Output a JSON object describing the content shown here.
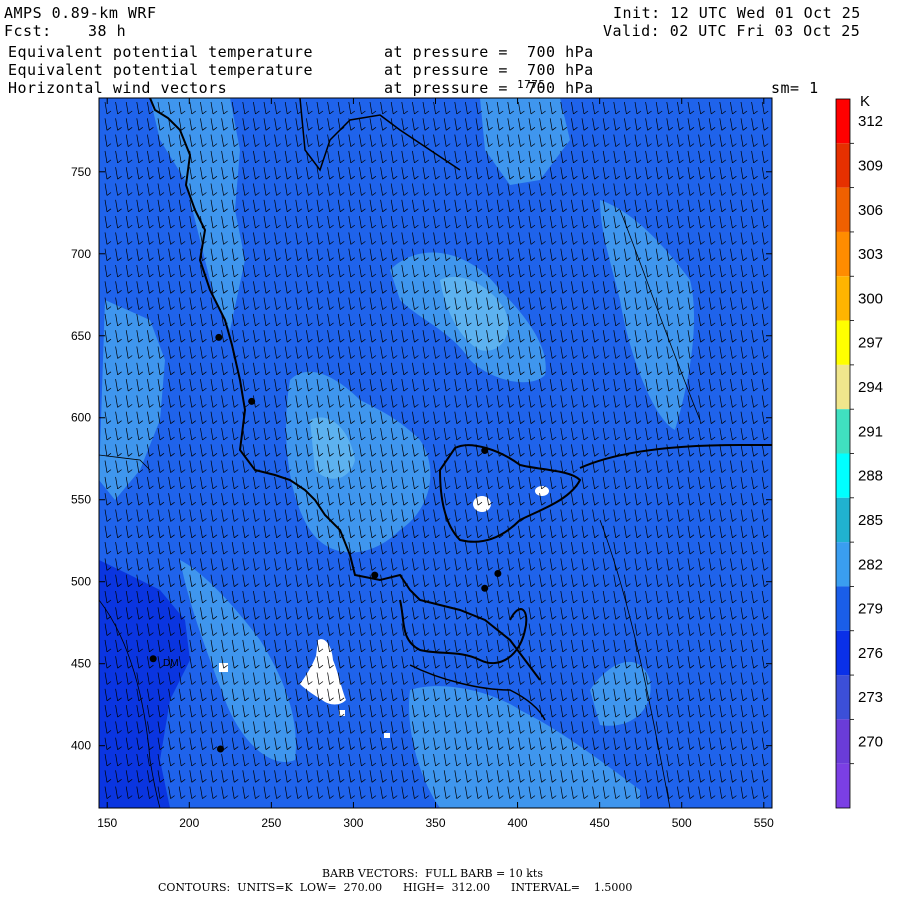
{
  "header": {
    "model": "AMPS 0.89-km WRF",
    "init": "Init: 12 UTC Wed 01 Oct 25",
    "fcst_label": "Fcst:",
    "fcst_value": "38 h",
    "valid": "Valid: 02 UTC Fri 03 Oct 25",
    "line1_field": "Equivalent potential temperature",
    "line1_level": "at pressure =  700 hPa",
    "line2_field": "Equivalent potential temperature",
    "line2_level": "at pressure =  700 hPa",
    "line3_field": "Horizontal wind vectors",
    "line3_level": "at pressure =  700 hPa",
    "overlay_label": "1775",
    "smoothing": "sm= 1"
  },
  "map": {
    "x_ticks": [
      "150",
      "200",
      "250",
      "300",
      "350",
      "400",
      "450",
      "500",
      "550"
    ],
    "y_ticks": [
      "750",
      "700",
      "650",
      "600",
      "550",
      "500",
      "450",
      "400"
    ],
    "x_tick_values": [
      150,
      200,
      250,
      300,
      350,
      400,
      450,
      500,
      550
    ],
    "y_tick_values": [
      750,
      700,
      650,
      600,
      550,
      500,
      450,
      400
    ],
    "x_range": [
      145,
      555
    ],
    "y_range": [
      362,
      795
    ],
    "inline_label": "DM",
    "station_points": [
      [
        218,
        649
      ],
      [
        238,
        610
      ],
      [
        313,
        504
      ],
      [
        380,
        496
      ],
      [
        388,
        505
      ],
      [
        178,
        453
      ],
      [
        219,
        398
      ],
      [
        380,
        580
      ]
    ],
    "colors": {
      "dark": "#0a35e0",
      "mid": "#1f63eb",
      "light": "#3f96ee",
      "lightest": "#5db2f0",
      "land_line": "#000000",
      "barb": "#000000"
    }
  },
  "colorbar": {
    "unit": "K",
    "labels": [
      "312",
      "309",
      "306",
      "303",
      "300",
      "297",
      "294",
      "291",
      "288",
      "285",
      "282",
      "279",
      "276",
      "273",
      "270"
    ],
    "colors": [
      "#ff0000",
      "#e63000",
      "#f06000",
      "#ff8c00",
      "#ffb400",
      "#ffff00",
      "#f0e68c",
      "#40e0c0",
      "#00ffff",
      "#20b2d0",
      "#3a9ef0",
      "#1a5ee8",
      "#0a30e8",
      "#3c4fd8",
      "#6a3cd8",
      "#7b3fe4"
    ]
  },
  "footer": {
    "line1": "BARB VECTORS:  FULL BARB = 10 kts",
    "line2": "CONTOURS:  UNITS=K  LOW=  270.00      HIGH=  312.00      INTERVAL=    1.5000"
  }
}
